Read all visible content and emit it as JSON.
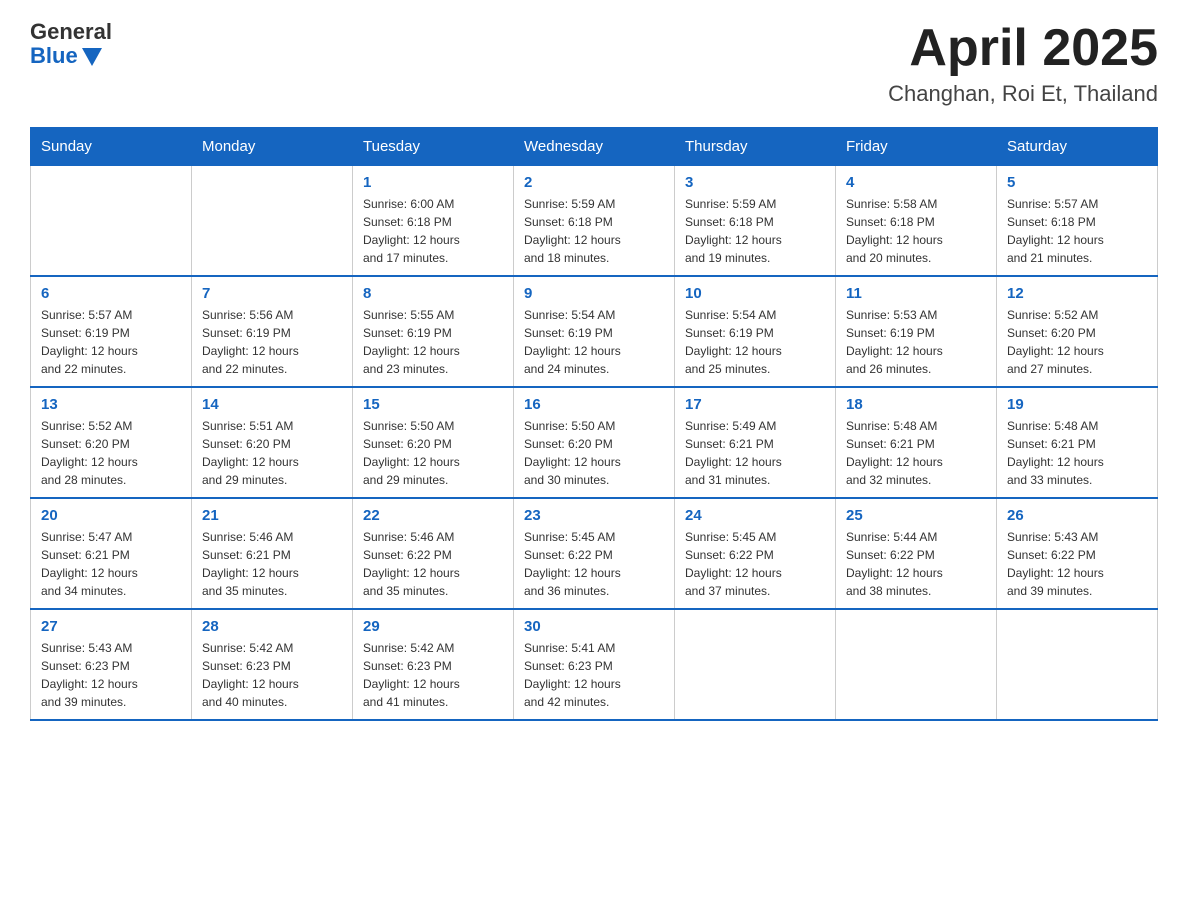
{
  "header": {
    "logo_general": "General",
    "logo_blue": "Blue",
    "month_title": "April 2025",
    "location": "Changhan, Roi Et, Thailand"
  },
  "weekdays": [
    "Sunday",
    "Monday",
    "Tuesday",
    "Wednesday",
    "Thursday",
    "Friday",
    "Saturday"
  ],
  "weeks": [
    [
      {
        "day": "",
        "info": ""
      },
      {
        "day": "",
        "info": ""
      },
      {
        "day": "1",
        "info": "Sunrise: 6:00 AM\nSunset: 6:18 PM\nDaylight: 12 hours\nand 17 minutes."
      },
      {
        "day": "2",
        "info": "Sunrise: 5:59 AM\nSunset: 6:18 PM\nDaylight: 12 hours\nand 18 minutes."
      },
      {
        "day": "3",
        "info": "Sunrise: 5:59 AM\nSunset: 6:18 PM\nDaylight: 12 hours\nand 19 minutes."
      },
      {
        "day": "4",
        "info": "Sunrise: 5:58 AM\nSunset: 6:18 PM\nDaylight: 12 hours\nand 20 minutes."
      },
      {
        "day": "5",
        "info": "Sunrise: 5:57 AM\nSunset: 6:18 PM\nDaylight: 12 hours\nand 21 minutes."
      }
    ],
    [
      {
        "day": "6",
        "info": "Sunrise: 5:57 AM\nSunset: 6:19 PM\nDaylight: 12 hours\nand 22 minutes."
      },
      {
        "day": "7",
        "info": "Sunrise: 5:56 AM\nSunset: 6:19 PM\nDaylight: 12 hours\nand 22 minutes."
      },
      {
        "day": "8",
        "info": "Sunrise: 5:55 AM\nSunset: 6:19 PM\nDaylight: 12 hours\nand 23 minutes."
      },
      {
        "day": "9",
        "info": "Sunrise: 5:54 AM\nSunset: 6:19 PM\nDaylight: 12 hours\nand 24 minutes."
      },
      {
        "day": "10",
        "info": "Sunrise: 5:54 AM\nSunset: 6:19 PM\nDaylight: 12 hours\nand 25 minutes."
      },
      {
        "day": "11",
        "info": "Sunrise: 5:53 AM\nSunset: 6:19 PM\nDaylight: 12 hours\nand 26 minutes."
      },
      {
        "day": "12",
        "info": "Sunrise: 5:52 AM\nSunset: 6:20 PM\nDaylight: 12 hours\nand 27 minutes."
      }
    ],
    [
      {
        "day": "13",
        "info": "Sunrise: 5:52 AM\nSunset: 6:20 PM\nDaylight: 12 hours\nand 28 minutes."
      },
      {
        "day": "14",
        "info": "Sunrise: 5:51 AM\nSunset: 6:20 PM\nDaylight: 12 hours\nand 29 minutes."
      },
      {
        "day": "15",
        "info": "Sunrise: 5:50 AM\nSunset: 6:20 PM\nDaylight: 12 hours\nand 29 minutes."
      },
      {
        "day": "16",
        "info": "Sunrise: 5:50 AM\nSunset: 6:20 PM\nDaylight: 12 hours\nand 30 minutes."
      },
      {
        "day": "17",
        "info": "Sunrise: 5:49 AM\nSunset: 6:21 PM\nDaylight: 12 hours\nand 31 minutes."
      },
      {
        "day": "18",
        "info": "Sunrise: 5:48 AM\nSunset: 6:21 PM\nDaylight: 12 hours\nand 32 minutes."
      },
      {
        "day": "19",
        "info": "Sunrise: 5:48 AM\nSunset: 6:21 PM\nDaylight: 12 hours\nand 33 minutes."
      }
    ],
    [
      {
        "day": "20",
        "info": "Sunrise: 5:47 AM\nSunset: 6:21 PM\nDaylight: 12 hours\nand 34 minutes."
      },
      {
        "day": "21",
        "info": "Sunrise: 5:46 AM\nSunset: 6:21 PM\nDaylight: 12 hours\nand 35 minutes."
      },
      {
        "day": "22",
        "info": "Sunrise: 5:46 AM\nSunset: 6:22 PM\nDaylight: 12 hours\nand 35 minutes."
      },
      {
        "day": "23",
        "info": "Sunrise: 5:45 AM\nSunset: 6:22 PM\nDaylight: 12 hours\nand 36 minutes."
      },
      {
        "day": "24",
        "info": "Sunrise: 5:45 AM\nSunset: 6:22 PM\nDaylight: 12 hours\nand 37 minutes."
      },
      {
        "day": "25",
        "info": "Sunrise: 5:44 AM\nSunset: 6:22 PM\nDaylight: 12 hours\nand 38 minutes."
      },
      {
        "day": "26",
        "info": "Sunrise: 5:43 AM\nSunset: 6:22 PM\nDaylight: 12 hours\nand 39 minutes."
      }
    ],
    [
      {
        "day": "27",
        "info": "Sunrise: 5:43 AM\nSunset: 6:23 PM\nDaylight: 12 hours\nand 39 minutes."
      },
      {
        "day": "28",
        "info": "Sunrise: 5:42 AM\nSunset: 6:23 PM\nDaylight: 12 hours\nand 40 minutes."
      },
      {
        "day": "29",
        "info": "Sunrise: 5:42 AM\nSunset: 6:23 PM\nDaylight: 12 hours\nand 41 minutes."
      },
      {
        "day": "30",
        "info": "Sunrise: 5:41 AM\nSunset: 6:23 PM\nDaylight: 12 hours\nand 42 minutes."
      },
      {
        "day": "",
        "info": ""
      },
      {
        "day": "",
        "info": ""
      },
      {
        "day": "",
        "info": ""
      }
    ]
  ]
}
